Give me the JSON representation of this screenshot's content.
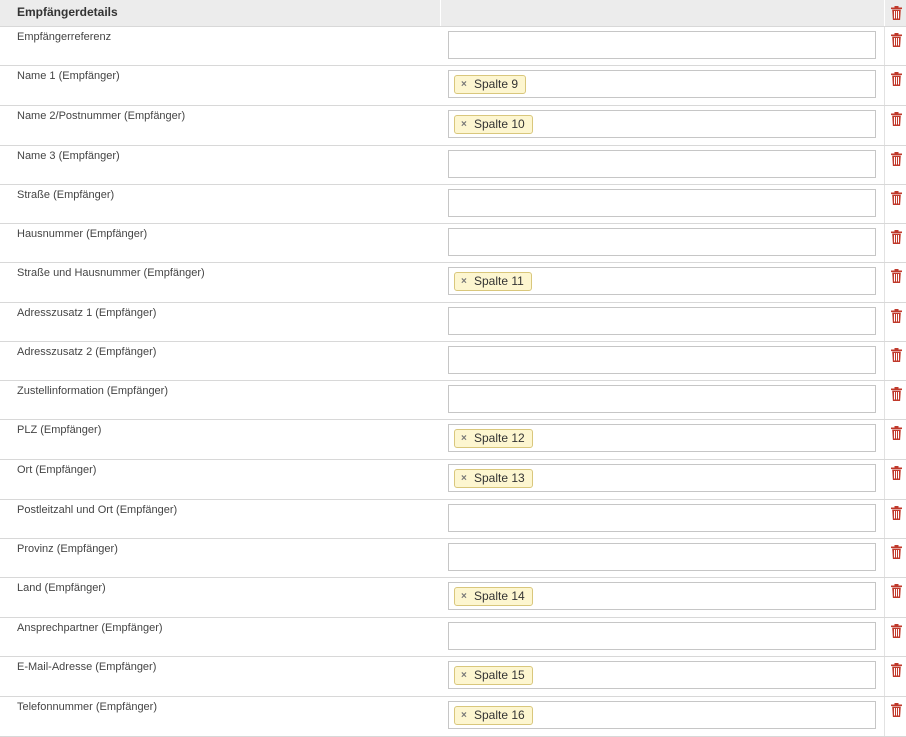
{
  "section": {
    "title": "Empfängerdetails"
  },
  "tag_remove_glyph": "×",
  "rows": [
    {
      "label": "Empfängerreferenz",
      "tag": null,
      "height": 39
    },
    {
      "label": "Name 1 (Empfänger)",
      "tag": "Spalte 9",
      "height": 40
    },
    {
      "label": "Name 2/Postnummer (Empfänger)",
      "tag": "Spalte 10",
      "height": 40
    },
    {
      "label": "Name 3 (Empfänger)",
      "tag": null,
      "height": 39
    },
    {
      "label": "Straße (Empfänger)",
      "tag": null,
      "height": 39
    },
    {
      "label": "Hausnummer (Empfänger)",
      "tag": null,
      "height": 39
    },
    {
      "label": "Straße und Hausnummer (Empfänger)",
      "tag": "Spalte 11",
      "height": 40
    },
    {
      "label": "Adresszusatz 1 (Empfänger)",
      "tag": null,
      "height": 39
    },
    {
      "label": "Adresszusatz 2 (Empfänger)",
      "tag": null,
      "height": 39
    },
    {
      "label": "Zustellinformation (Empfänger)",
      "tag": null,
      "height": 39
    },
    {
      "label": "PLZ (Empfänger)",
      "tag": "Spalte 12",
      "height": 40
    },
    {
      "label": "Ort (Empfänger)",
      "tag": "Spalte 13",
      "height": 40
    },
    {
      "label": "Postleitzahl und Ort (Empfänger)",
      "tag": null,
      "height": 39
    },
    {
      "label": "Provinz (Empfänger)",
      "tag": null,
      "height": 39
    },
    {
      "label": "Land (Empfänger)",
      "tag": "Spalte 14",
      "height": 40
    },
    {
      "label": "Ansprechpartner (Empfänger)",
      "tag": null,
      "height": 39
    },
    {
      "label": "E-Mail-Adresse (Empfänger)",
      "tag": "Spalte 15",
      "height": 40
    },
    {
      "label": "Telefonnummer (Empfänger)",
      "tag": "Spalte 16",
      "height": 40
    }
  ],
  "colors": {
    "header_bg": "#ececec",
    "tag_bg": "#fdf6d0",
    "tag_border": "#d9c77c",
    "delete_icon": "#c0392b"
  },
  "icons": {
    "delete": "trash-icon",
    "remove_tag": "close-icon"
  }
}
